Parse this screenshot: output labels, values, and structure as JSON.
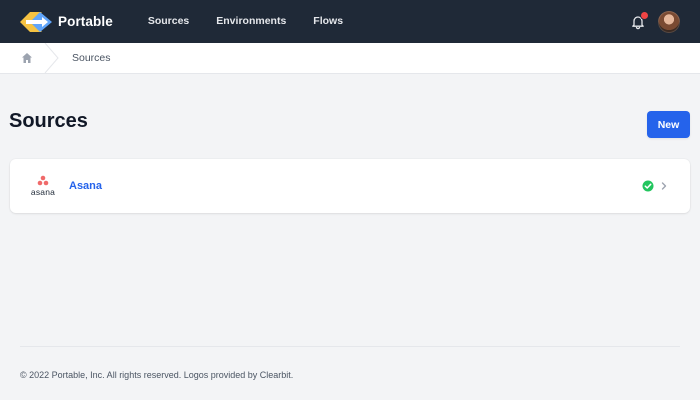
{
  "header": {
    "brand_name": "Portable",
    "nav": [
      "Sources",
      "Environments",
      "Flows"
    ],
    "icons": {
      "logo": "portable-arrows-logo",
      "notifications": "bell-icon",
      "avatar": "user-avatar"
    },
    "has_unread_notifications": true
  },
  "breadcrumb": {
    "home_icon": "home-icon",
    "current": "Sources"
  },
  "page": {
    "title": "Sources",
    "new_button_label": "New"
  },
  "sources": [
    {
      "logo_text": "asana",
      "name": "Asana",
      "status": "connected",
      "status_icon": "check-circle-icon"
    }
  ],
  "colors": {
    "topbar": "#1f2937",
    "accent": "#2563eb",
    "status_ok": "#22c55e",
    "notification": "#ef4444"
  },
  "footer": {
    "text": "© 2022 Portable, Inc. All rights reserved. Logos provided by Clearbit."
  }
}
